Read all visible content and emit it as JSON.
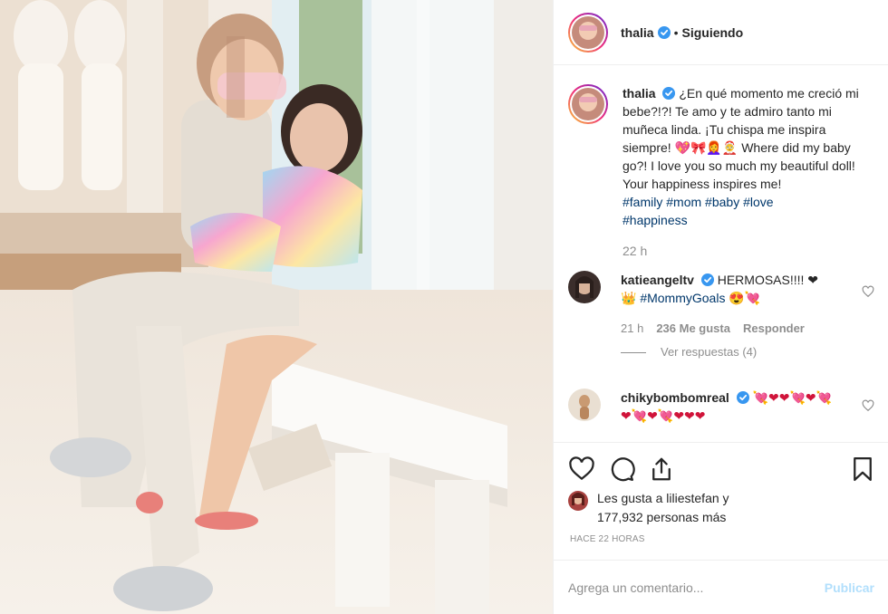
{
  "header": {
    "username": "thalia",
    "separator": "•",
    "follow_status": "Siguiendo"
  },
  "caption": {
    "username": "thalia",
    "text_plain": "¿En qué momento me creció mi bebe?!?! Te amo y te admiro tanto mi muñeca linda. ¡Tu chispa me inspira siempre! 💖🎀👩‍🦰🤶 Where did my baby go?! I love you so much my beautiful doll! Your happiness inspires me!",
    "hashtags": [
      "#family",
      "#mom",
      "#baby",
      "#love",
      "#happiness"
    ],
    "time": "22 h"
  },
  "comments": [
    {
      "username": "katieangeltv",
      "text": "HERMOSAS!!!! ❤",
      "text2": "👑 #MommyGoals 😍💘",
      "time": "21 h",
      "likes": "236 Me gusta",
      "reply_label": "Responder",
      "view_replies": "Ver respuestas (4)"
    },
    {
      "username": "chikybombomreal",
      "text": "💘❤❤💘❤💘",
      "text2": "❤💘❤💘❤❤❤"
    }
  ],
  "likes": {
    "prefix": "Les gusta a",
    "user": "liliestefan",
    "suffix": "y",
    "others": "177,932 personas más"
  },
  "posted_ago": "HACE 22 HORAS",
  "add_comment": {
    "placeholder": "Agrega un comentario...",
    "publish_label": "Publicar"
  },
  "colors": {
    "verified": "#3897f0",
    "hashtag": "#00376b",
    "meta": "#8e8e8e",
    "publish_disabled": "#b2dffc"
  },
  "icons": [
    "verified-badge-icon",
    "heart-icon",
    "comment-icon",
    "share-icon",
    "bookmark-icon"
  ]
}
